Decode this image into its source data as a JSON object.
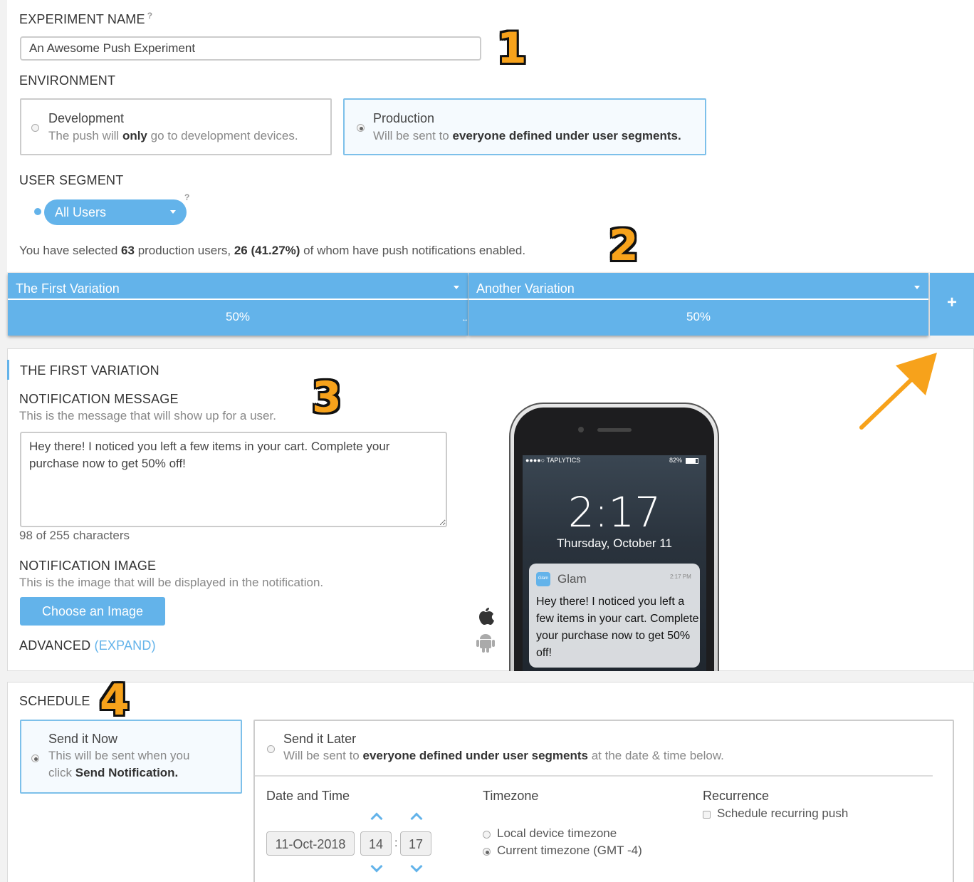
{
  "experiment": {
    "name_label": "EXPERIMENT NAME",
    "name_help": "?",
    "name_value": "An Awesome Push Experiment"
  },
  "environment": {
    "label": "ENVIRONMENT",
    "development": {
      "title": "Development",
      "desc_a": "The push will ",
      "desc_b": "only",
      "desc_c": " go to development devices."
    },
    "production": {
      "title": "Production",
      "desc_a": "Will be sent to ",
      "desc_b": "everyone defined under user segments."
    },
    "selected": "production"
  },
  "segment": {
    "label": "USER SEGMENT",
    "help": "?",
    "selected": "All Users",
    "summary_a": "You have selected ",
    "summary_count": "63",
    "summary_b": " production users, ",
    "summary_enabled": "26 (41.27%)",
    "summary_c": " of whom have push notifications enabled."
  },
  "badges": [
    "1",
    "2",
    "3",
    "4"
  ],
  "variations": [
    {
      "name": "The First Variation",
      "percent": "50%"
    },
    {
      "name": "Another Variation",
      "percent": "50%"
    }
  ],
  "add_variation_label": "+",
  "variation_detail": {
    "title": "THE FIRST VARIATION",
    "message_label": "NOTIFICATION MESSAGE",
    "message_help": "This is the message that will show up for a user.",
    "message_value": "Hey there! I noticed you left a few items in your cart. Complete your purchase now to get 50% off!",
    "char_count": "98 of 255 characters",
    "image_label": "NOTIFICATION IMAGE",
    "image_help": "This is the image that will be displayed in the notification.",
    "choose_image": "Choose an Image",
    "advanced_label": "ADVANCED",
    "expand_label": "(EXPAND)"
  },
  "phone": {
    "carrier": "●●●●○ TAPLYTICS",
    "battery": "82%",
    "time": "2:17",
    "date": "Thursday, October 11",
    "app_icon_text": "Glam",
    "app_name": "Glam",
    "notif_time": "2:17 PM",
    "notif_text": "Hey there! I noticed you left a few items in your cart. Complete your purchase now to get 50% off!"
  },
  "platforms": [
    "apple-icon",
    "android-icon"
  ],
  "schedule": {
    "label": "SCHEDULE",
    "now": {
      "title": "Send it Now",
      "desc_a": "This will be sent when you",
      "desc_b": "click ",
      "desc_c": "Send Notification."
    },
    "later": {
      "title": "Send it Later",
      "desc_a": "Will be sent to ",
      "desc_b": "everyone defined under user segments",
      "desc_c": " at the date & time below."
    },
    "selected": "now",
    "date_time_label": "Date and Time",
    "date_value": "11-Oct-2018",
    "hour_value": "14",
    "minute_value": "17",
    "separator": ":",
    "timezone_label": "Timezone",
    "tz_local": "Local device timezone",
    "tz_current": "Current timezone (GMT -4)",
    "recurrence_label": "Recurrence",
    "recurring_label": "Schedule recurring push"
  },
  "colors": {
    "accent": "#63b3ea",
    "badge": "#f7a21b",
    "arrow": "#f7a21b"
  }
}
